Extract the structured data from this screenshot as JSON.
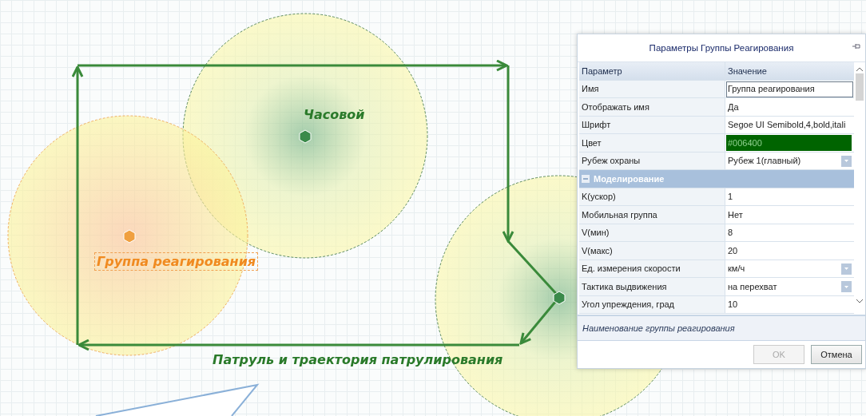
{
  "canvas": {
    "objects": [
      {
        "kind": "guard",
        "label": "Часовой",
        "selected": false
      },
      {
        "kind": "response",
        "label": "Группа реагирования",
        "selected": true
      },
      {
        "kind": "patrol",
        "label": "Патруль и траектория патрулирования",
        "selected": false
      }
    ]
  },
  "dialog": {
    "title": "Параметры Группы Реагирования",
    "columns": [
      "Параметр",
      "Значение"
    ],
    "rows": [
      {
        "kind": "text",
        "name": "Имя",
        "value": "Группа реагирования",
        "selected": true
      },
      {
        "kind": "text",
        "name": "Отображать имя",
        "value": "Да",
        "selected": false
      },
      {
        "kind": "text",
        "name": "Шрифт",
        "value": "Segoe UI Semibold,4,bold,itali",
        "selected": false
      },
      {
        "kind": "color",
        "name": "Цвет",
        "value": "#006400",
        "color": "#006400",
        "selected": false
      },
      {
        "kind": "dropdown",
        "name": "Рубеж охраны",
        "value": "Рубеж 1(главный)",
        "selected": false
      },
      {
        "kind": "category",
        "name": "Моделирование",
        "expanded": true
      },
      {
        "kind": "text",
        "name": "K(ускор)",
        "value": "1",
        "selected": false
      },
      {
        "kind": "text",
        "name": "Мобильная группа",
        "value": "Нет",
        "selected": false
      },
      {
        "kind": "text",
        "name": "V(мин)",
        "value": "8",
        "selected": false
      },
      {
        "kind": "text",
        "name": "V(макс)",
        "value": "20",
        "selected": false
      },
      {
        "kind": "dropdown",
        "name": "Ед. измерения скорости",
        "value": "км/ч",
        "selected": false
      },
      {
        "kind": "dropdown",
        "name": "Тактика выдвижения",
        "value": "на перехват",
        "selected": false
      },
      {
        "kind": "text",
        "name": "Угол упреждения, град",
        "value": "10",
        "selected": false
      }
    ],
    "description": "Наименование группы реагирования",
    "buttons": [
      {
        "label": "OK",
        "disabled": true
      },
      {
        "label": "Отмена",
        "disabled": false
      }
    ]
  }
}
